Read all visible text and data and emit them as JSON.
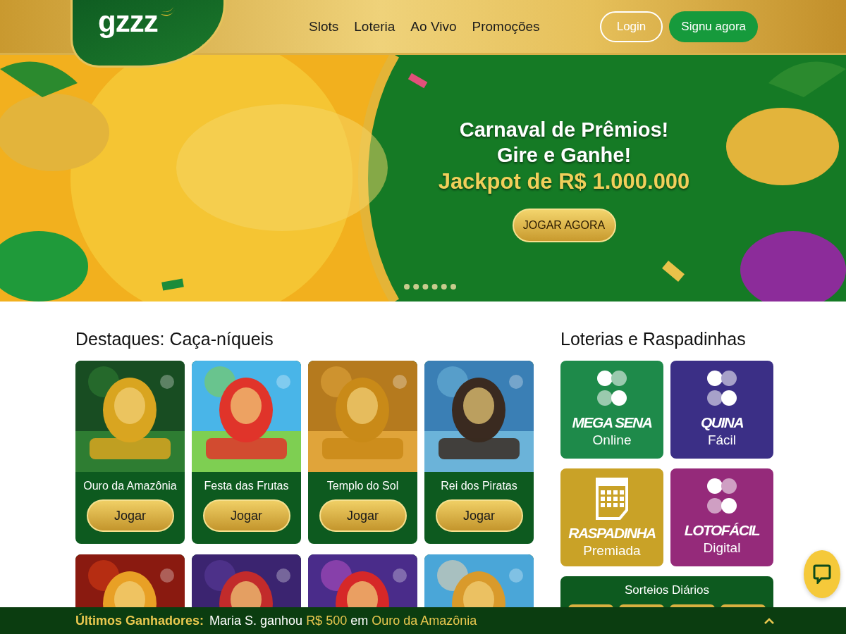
{
  "header": {
    "logo": "gzzz",
    "nav": [
      {
        "label": "Slots"
      },
      {
        "label": "Loteria"
      },
      {
        "label": "Ao Vivo"
      },
      {
        "label": "Promoções"
      }
    ],
    "login": "Login",
    "signup": "Signu agora"
  },
  "banner": {
    "kind": "picture",
    "lines": [
      "Carnaval de Prêmios!",
      "Gire e Ganhe!"
    ],
    "jackpot": "Jackpot de R$ 1.000.000",
    "cta": "JOGAR AGORA"
  },
  "slots": {
    "title": "Destaques: Caça-níqueis",
    "games": [
      {
        "kind": "game",
        "name": "Ouro da Amazônia",
        "button": "Jogar"
      },
      {
        "kind": "game",
        "name": "Festa das Frutas",
        "button": "Jogar"
      },
      {
        "kind": "game",
        "name": "Templo do Sol",
        "button": "Jogar"
      },
      {
        "kind": "game",
        "name": "Rei dos Piratas",
        "button": "Jogar"
      },
      {
        "kind": "picture"
      },
      {
        "kind": "picture"
      },
      {
        "kind": "picture"
      },
      {
        "kind": "picture"
      }
    ]
  },
  "lotteries": {
    "title": "Loterias e Raspadinhas",
    "tiles": [
      {
        "kind": "clover",
        "title": "MEGA SENA",
        "subtitle": "Online",
        "color": "#1e8a4a"
      },
      {
        "kind": "clover",
        "title": "QUINA",
        "subtitle": "Fácil",
        "color": "#3b2f86"
      },
      {
        "kind": "ticket",
        "title": "RASPADINHA",
        "subtitle": "Premiada",
        "color": "#c9a227"
      },
      {
        "kind": "clover",
        "title": "LOTOFÁCIL",
        "subtitle": "Digital",
        "color": "#952a7a"
      }
    ],
    "draws": {
      "title": "Sorteios Diários"
    }
  },
  "ticker": {
    "label": "Últimos Ganhadores:",
    "segments": [
      {
        "text": "Maria S. ganhou ",
        "highlight": false
      },
      {
        "text": "R$ 500",
        "highlight": true
      },
      {
        "text": " em ",
        "highlight": false
      },
      {
        "text": "Ouro da Amazônia",
        "highlight": true
      }
    ]
  }
}
